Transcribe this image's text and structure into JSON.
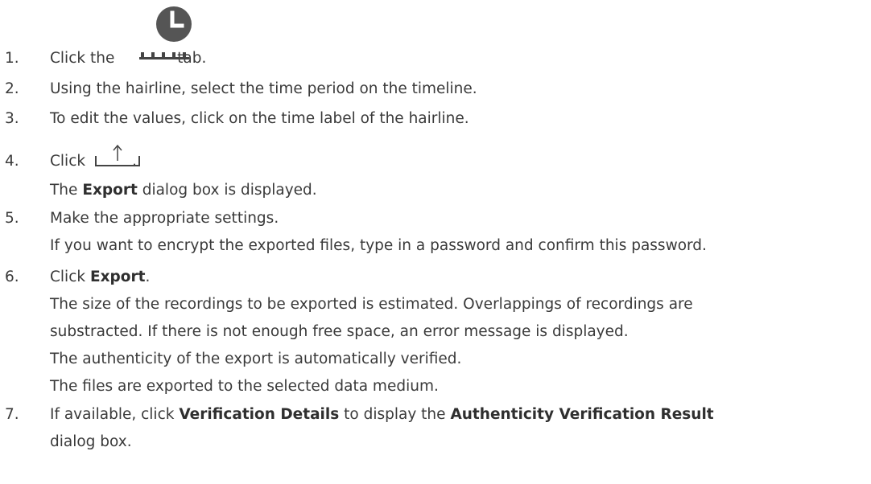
{
  "steps": [
    {
      "num": "1.",
      "before": "Click the",
      "after": "tab.",
      "icon": "clock-timeline-icon"
    },
    {
      "num": "2.",
      "text": "Using the hairline, select the time period on the timeline."
    },
    {
      "num": "3.",
      "text": "To edit the values, click on the time label of the hairline."
    },
    {
      "num": "4.",
      "before": "Click",
      "after": ".",
      "icon": "export-icon",
      "sub": {
        "before": "The",
        "bold": "Export",
        "after": "dialog box is displayed."
      }
    },
    {
      "num": "5.",
      "text": "Make the appropriate settings.",
      "sub": "If you want to encrypt the exported files, type in a password and confirm this password."
    },
    {
      "num": "6.",
      "before": "Click",
      "bold": "Export",
      "after": ".",
      "sub1": "The size of the recordings to be exported is estimated. Overlappings of recordings are",
      "sub2": "substracted. If there is not enough free space, an error message is displayed.",
      "sub3": "The authenticity of the export is automatically verified.",
      "sub4": "The files are exported to the selected data medium."
    },
    {
      "num": "7.",
      "before": "If available, click",
      "bold1": "Verification Details",
      "mid": "to display the",
      "bold2": "Authenticity Verification Result",
      "line2": "dialog box."
    }
  ]
}
